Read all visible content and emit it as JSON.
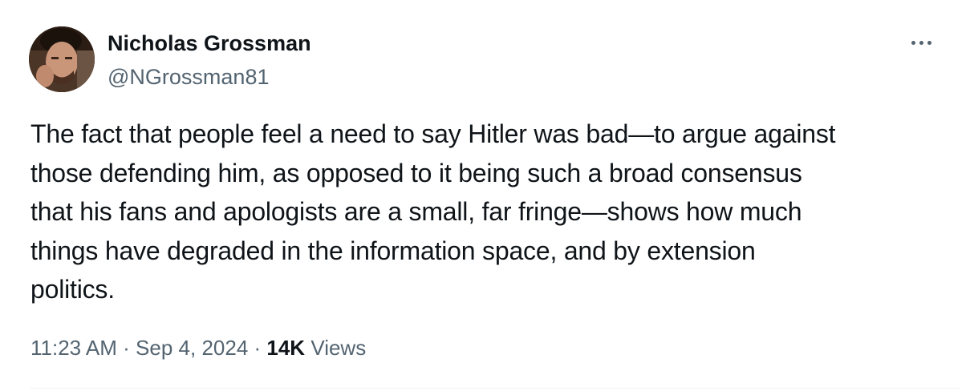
{
  "author": {
    "name": "Nicholas Grossman",
    "handle": "@NGrossman81",
    "avatar_alt": "profile photo"
  },
  "more_button": {
    "icon": "more-horizontal-icon"
  },
  "tweet": {
    "lines": [
      "The fact that people feel a need to say Hitler was bad—to argue against",
      "those defending him, as opposed to it being such a broad consensus",
      "that his fans and apologists are a small, far fringe—shows how much",
      "things have degraded in the information space, and by extension",
      "politics."
    ]
  },
  "meta": {
    "time": "11:23 AM",
    "separator": " · ",
    "date": "Sep 4, 2024",
    "views_count": "14K",
    "views_label": " Views"
  },
  "colors": {
    "text_primary": "#0f1419",
    "text_secondary": "#536471",
    "divider": "#eff3f4"
  }
}
